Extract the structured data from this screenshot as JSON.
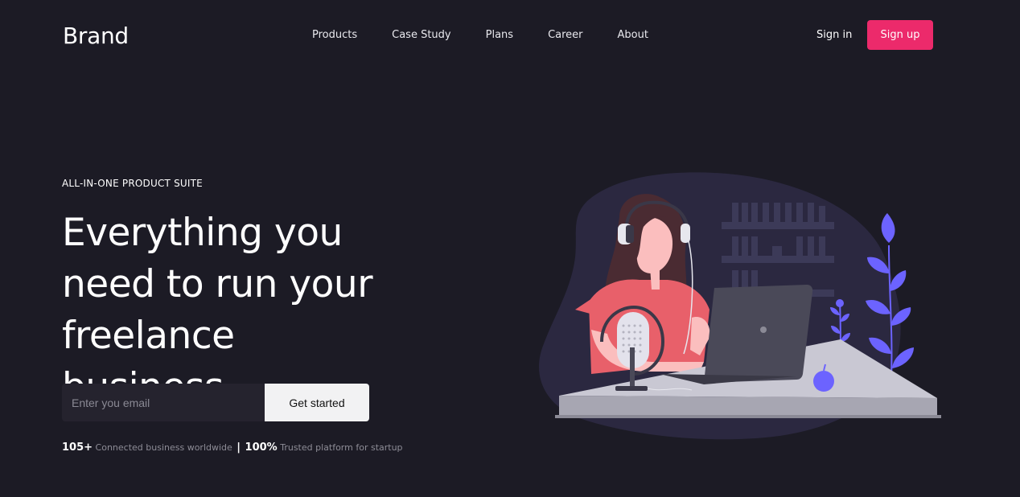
{
  "header": {
    "brand": "Brand",
    "nav": [
      "Products",
      "Case Study",
      "Plans",
      "Career",
      "About"
    ],
    "sign_in": "Sign in",
    "sign_up": "Sign up"
  },
  "hero": {
    "eyebrow": "ALL-IN-ONE PRODUCT SUITE",
    "headline_lines": [
      "Everything you",
      "need to run your",
      "freelance business"
    ],
    "email_placeholder": "Enter you email",
    "cta": "Get started",
    "stats": {
      "stat1_value": "105+",
      "stat1_label": "Connected business worldwide",
      "separator": "|",
      "stat2_value": "100%",
      "stat2_label": "Trusted platform for startup"
    }
  },
  "colors": {
    "background": "#1c1b25",
    "accent": "#ec2a6b",
    "illustration_purple": "#6c63ff"
  }
}
